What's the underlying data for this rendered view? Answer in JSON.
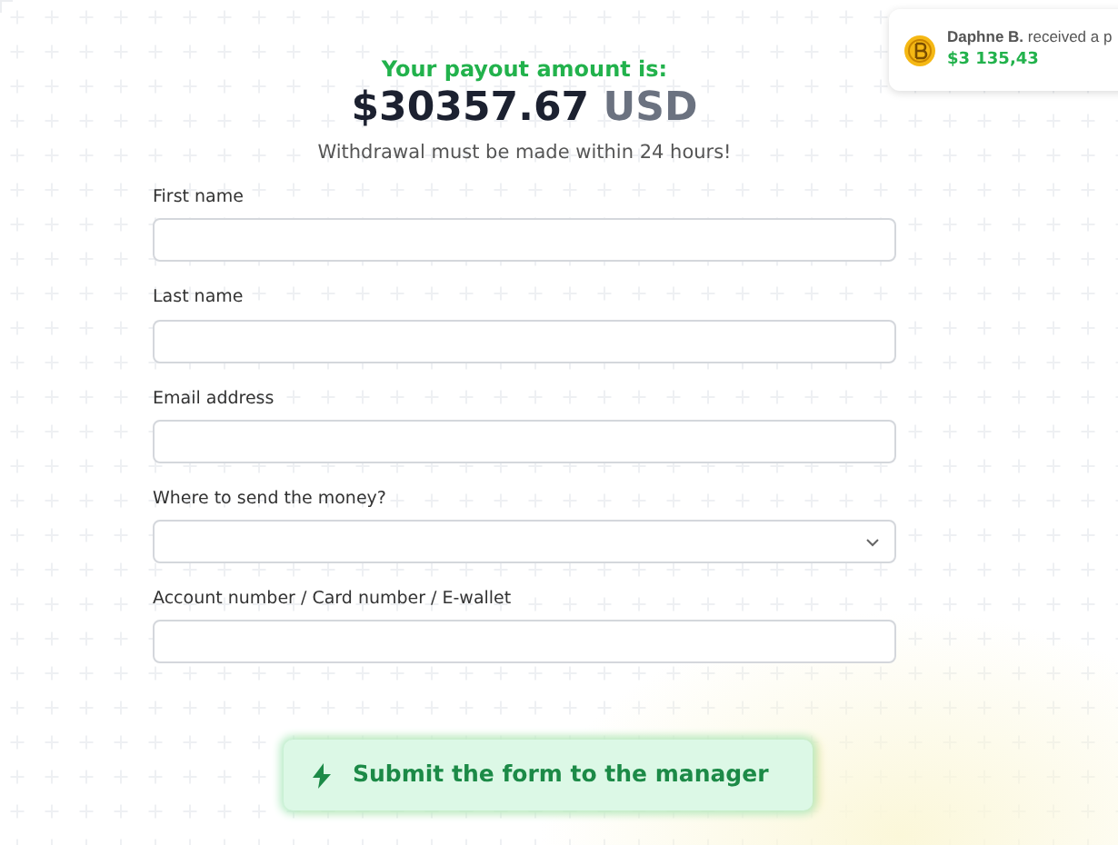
{
  "header": {
    "title": "Your payout amount is:",
    "amount": "$30357.67",
    "currency": "USD",
    "note": "Withdrawal must be made within 24 hours!"
  },
  "fields": [
    {
      "kind": "input",
      "label": "First name"
    },
    {
      "kind": "input",
      "label": "Last name"
    },
    {
      "kind": "input",
      "label": "Email address"
    },
    {
      "kind": "select",
      "label": "Where to send the money?"
    },
    {
      "kind": "input",
      "label": "Account number / Card number / E-wallet"
    }
  ],
  "submit_button": {
    "label": "Submit the form to the manager"
  },
  "notification": {
    "name": "Daphne B.",
    "text": "received a p",
    "amount": "$3 135,43"
  }
}
